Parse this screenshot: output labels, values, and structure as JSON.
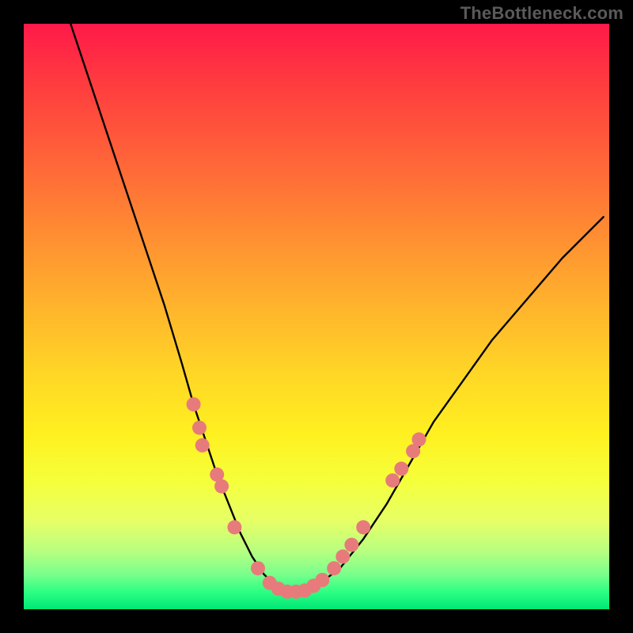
{
  "watermark": "TheBottleneck.com",
  "chart_data": {
    "type": "line",
    "title": "",
    "xlabel": "",
    "ylabel": "",
    "xlim": [
      0,
      100
    ],
    "ylim": [
      0,
      100
    ],
    "grid": false,
    "legend": "none",
    "series": [
      {
        "name": "bottleneck-curve",
        "x": [
          8,
          12,
          16,
          20,
          24,
          27,
          29,
          31,
          33,
          35,
          37,
          39,
          41,
          43,
          45,
          47,
          50,
          54,
          58,
          62,
          66,
          70,
          75,
          80,
          86,
          92,
          99
        ],
        "y": [
          100,
          88,
          76,
          64,
          52,
          42,
          35,
          29,
          23,
          18,
          13,
          9,
          6,
          4,
          3,
          3,
          4,
          7,
          12,
          18,
          25,
          32,
          39,
          46,
          53,
          60,
          67
        ]
      }
    ],
    "markers": {
      "name": "highlight-dots",
      "color": "#e77b7b",
      "points": [
        {
          "x": 29,
          "y": 35
        },
        {
          "x": 30,
          "y": 31
        },
        {
          "x": 30.5,
          "y": 28
        },
        {
          "x": 33,
          "y": 23
        },
        {
          "x": 33.8,
          "y": 21
        },
        {
          "x": 36,
          "y": 14
        },
        {
          "x": 40,
          "y": 7
        },
        {
          "x": 42,
          "y": 4.5
        },
        {
          "x": 43.5,
          "y": 3.5
        },
        {
          "x": 45,
          "y": 3
        },
        {
          "x": 46.5,
          "y": 3
        },
        {
          "x": 48,
          "y": 3.2
        },
        {
          "x": 49.5,
          "y": 4
        },
        {
          "x": 51,
          "y": 5
        },
        {
          "x": 53,
          "y": 7
        },
        {
          "x": 54.5,
          "y": 9
        },
        {
          "x": 56,
          "y": 11
        },
        {
          "x": 58,
          "y": 14
        },
        {
          "x": 63,
          "y": 22
        },
        {
          "x": 64.5,
          "y": 24
        },
        {
          "x": 66.5,
          "y": 27
        },
        {
          "x": 67.5,
          "y": 29
        }
      ]
    },
    "gradient_stops": [
      {
        "pos": 0,
        "color": "#ff1a49"
      },
      {
        "pos": 50,
        "color": "#ffb92b"
      },
      {
        "pos": 78,
        "color": "#f5ff3a"
      },
      {
        "pos": 100,
        "color": "#00e676"
      }
    ]
  }
}
